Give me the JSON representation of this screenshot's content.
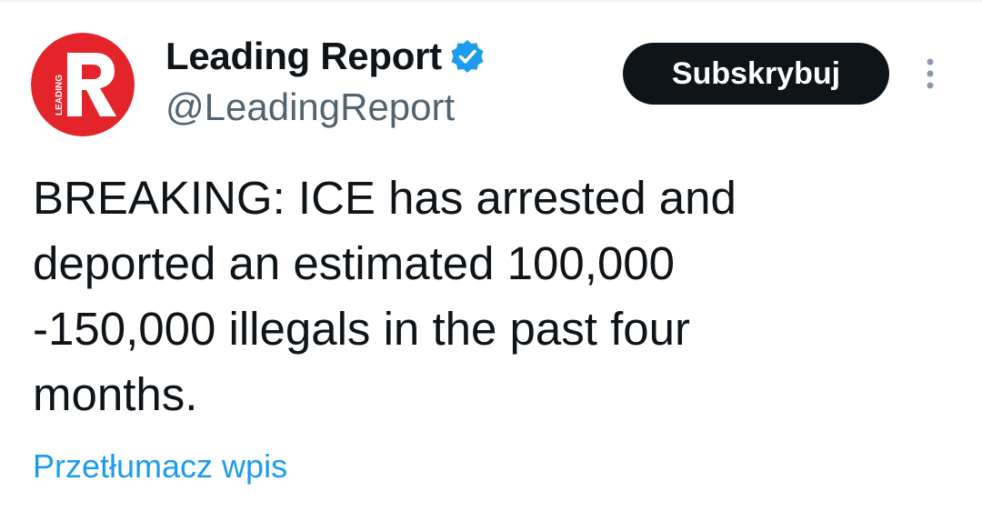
{
  "author": {
    "display_name": "Leading Report",
    "handle": "@LeadingReport",
    "verified": true,
    "avatar_text": "LEADING",
    "avatar_letter": "R"
  },
  "actions": {
    "subscribe_label": "Subskrybuj",
    "more_icon": "more-vertical-icon"
  },
  "tweet": {
    "text": "BREAKING: ICE has arrested and\ndeported an estimated 100,000\n-150,000 illegals in the past four\nmonths."
  },
  "translate_label": "Przetłumacz wpis",
  "colors": {
    "accent": "#1d9bf0",
    "text_primary": "#0f1419",
    "text_secondary": "#536471",
    "avatar_red": "#e4242b",
    "button_bg": "#0f1419",
    "more_dots": "#8b98a5"
  }
}
